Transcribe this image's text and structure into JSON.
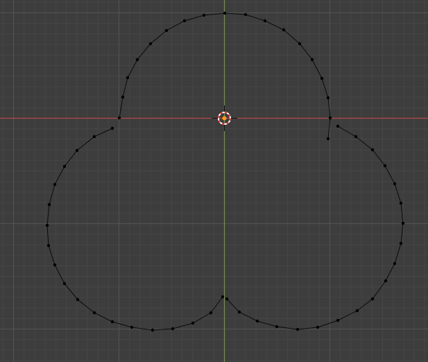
{
  "viewport": {
    "editor": "3d-viewport",
    "view": "top-orthographic",
    "mode": "edit-mode",
    "grid_visible": true,
    "colors": {
      "background": "#3d3d3d",
      "grid_minor": "#464646",
      "grid_major": "#545454",
      "x_axis": "#b34a4a",
      "y_axis": "#6f9c2c",
      "edge": "#0a0a0a",
      "vertex": "#000000",
      "origin": "#ff9a1a",
      "cursor_ring_red": "#e83434",
      "cursor_ring_white": "#ffffff"
    }
  },
  "mesh": {
    "type": "curve-outline",
    "shape": "three-lobed-trefoil",
    "loops": 3,
    "vertex_count": 72
  },
  "cursor_3d": {
    "icon": "3d-cursor-icon"
  },
  "object_origin": {
    "icon": "object-origin-dot"
  }
}
